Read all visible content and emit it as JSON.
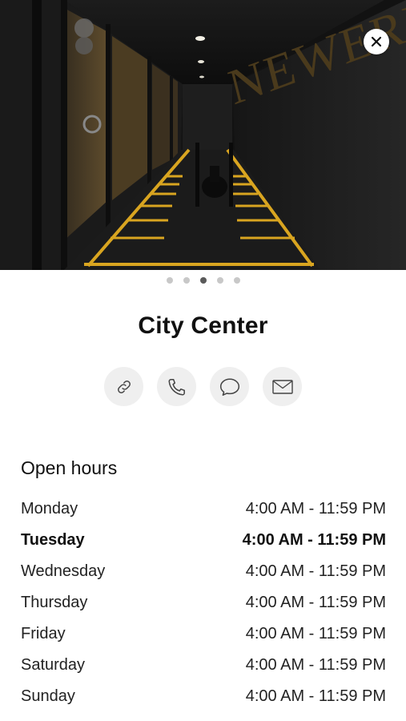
{
  "hero": {
    "image_label": "Gym hallway photo",
    "wall_text": "NEWERK"
  },
  "carousel": {
    "count": 5,
    "active_index": 2
  },
  "location": {
    "name": "City Center"
  },
  "actions": [
    {
      "icon": "link-icon"
    },
    {
      "icon": "phone-icon"
    },
    {
      "icon": "message-icon"
    },
    {
      "icon": "mail-icon"
    }
  ],
  "hours": {
    "title": "Open hours",
    "today_index": 1,
    "days": [
      {
        "day": "Monday",
        "time": "4:00 AM - 11:59 PM"
      },
      {
        "day": "Tuesday",
        "time": "4:00 AM - 11:59 PM"
      },
      {
        "day": "Wednesday",
        "time": "4:00 AM - 11:59 PM"
      },
      {
        "day": "Thursday",
        "time": "4:00 AM - 11:59 PM"
      },
      {
        "day": "Friday",
        "time": "4:00 AM - 11:59 PM"
      },
      {
        "day": "Saturday",
        "time": "4:00 AM - 11:59 PM"
      },
      {
        "day": "Sunday",
        "time": "4:00 AM - 11:59 PM"
      }
    ]
  },
  "colors": {
    "accent_yellow": "#d9a520",
    "dark": "#151515"
  }
}
